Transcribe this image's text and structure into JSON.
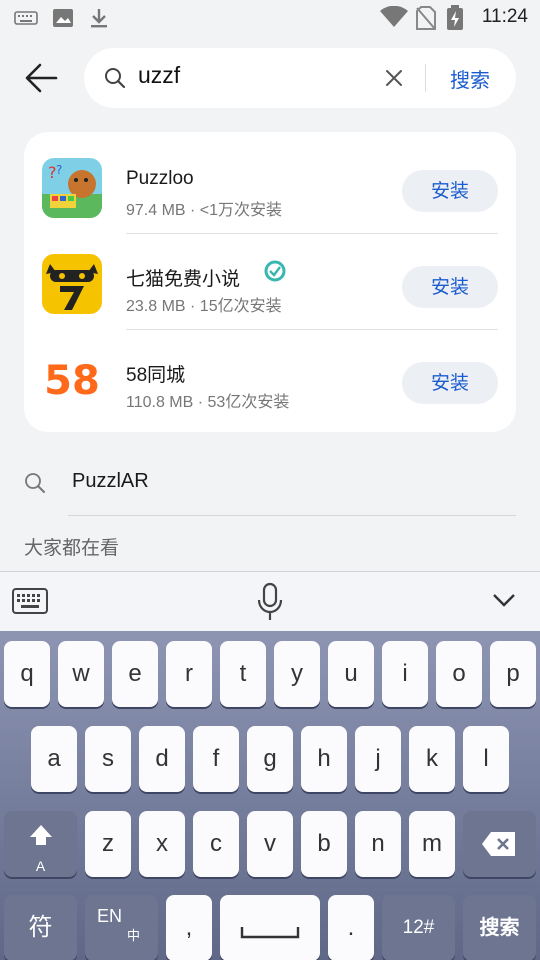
{
  "status_bar": {
    "time": "11:24"
  },
  "search": {
    "query": "uzzf",
    "submit_label": "搜索"
  },
  "results": [
    {
      "name": "Puzzloo",
      "meta": "97.4 MB · <1万次安装",
      "install_label": "安装"
    },
    {
      "name": "七猫免费小说",
      "meta": "23.8 MB · 15亿次安装",
      "install_label": "安装"
    },
    {
      "name": "58同城",
      "meta": "110.8 MB · 53亿次安装",
      "install_label": "安装"
    }
  ],
  "icon_text": {
    "app3": "58"
  },
  "suggestion": {
    "text": "PuzzlAR"
  },
  "section_title": "大家都在看",
  "keyboard": {
    "row1": [
      "q",
      "w",
      "e",
      "r",
      "t",
      "y",
      "u",
      "i",
      "o",
      "p"
    ],
    "row2": [
      "a",
      "s",
      "d",
      "f",
      "g",
      "h",
      "j",
      "k",
      "l"
    ],
    "row3": [
      "z",
      "x",
      "c",
      "v",
      "b",
      "n",
      "m"
    ],
    "shift_sub": "A",
    "symbols": "符",
    "lang": "EN",
    "lang_sub": "中",
    "comma": ",",
    "period": ".",
    "numbers": "12#",
    "search": "搜索"
  },
  "colors": {
    "accent": "#1a5ccf",
    "background": "#f1f3f5"
  }
}
